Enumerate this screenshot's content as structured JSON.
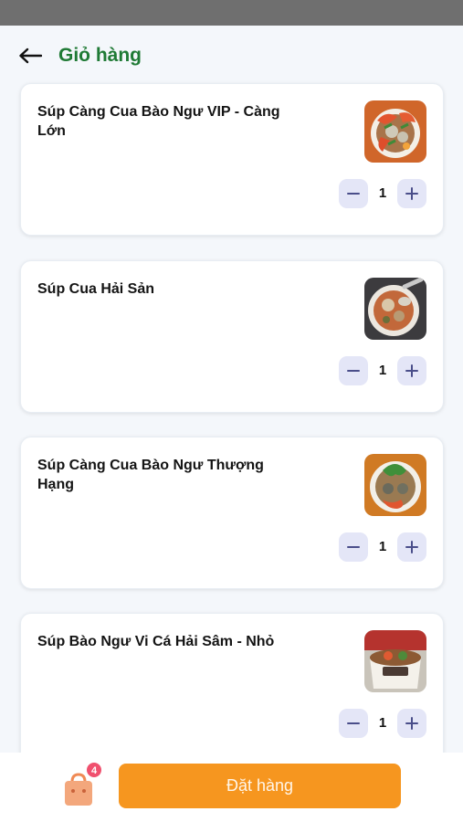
{
  "header": {
    "title": "Giỏ hàng",
    "back_icon": "arrow-left-icon"
  },
  "cart_items": [
    {
      "name": "Súp Càng Cua Bào Ngư VIP - Càng Lớn",
      "quantity": "1",
      "image": "crab-claw-soup-image"
    },
    {
      "name": "Súp Cua Hải Sản",
      "quantity": "1",
      "image": "seafood-crab-soup-image"
    },
    {
      "name": "Súp Càng Cua Bào Ngư Thượng Hạng",
      "quantity": "1",
      "image": "premium-abalone-soup-image"
    },
    {
      "name": "Súp Bào Ngư Vi Cá Hải Sâm - Nhỏ",
      "quantity": "1",
      "image": "abalone-sea-cucumber-soup-image"
    }
  ],
  "bottom_bar": {
    "cart_badge": "4",
    "order_button_label": "Đặt hàng"
  },
  "colors": {
    "title_green": "#1f7a35",
    "order_orange": "#f6961f",
    "badge_pink": "#f0506e",
    "qty_button_bg": "#e4e6f7",
    "qty_icon": "#4a4e8a"
  }
}
